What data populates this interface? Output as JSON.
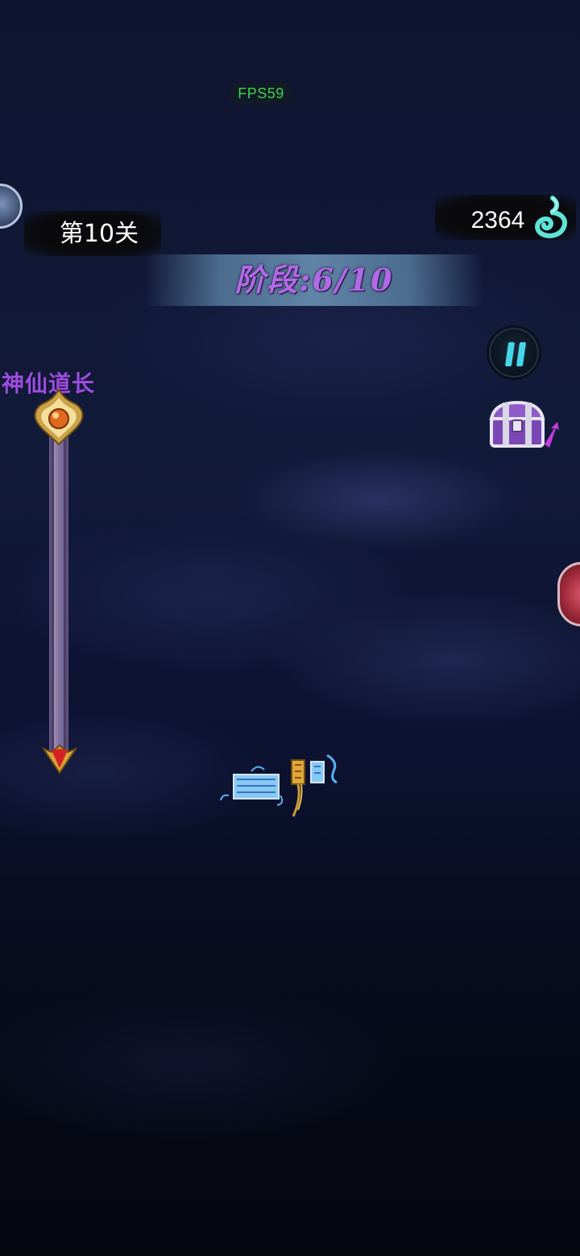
{
  "hud": {
    "fps_label": "FPS59",
    "level_label": "第10关",
    "soul_count": "2364",
    "stage_label": "阶段:6/10",
    "boss_name": "神仙道长",
    "boss_progress": 1.0
  },
  "icons": {
    "pause": "pause-icon",
    "treasure": "treasure-chest-icon",
    "soul": "soul-flame-icon",
    "boss": "boss-emblem-icon",
    "arrow": "progress-arrow-icon",
    "talismans": "talisman-icon"
  },
  "colors": {
    "stage_text": "#b06ae8",
    "boss_name": "#9a4ee0",
    "fps_text": "#3fd24a",
    "pause_bars": "#46d6e8",
    "soul_flame": "#5fe3d8"
  }
}
